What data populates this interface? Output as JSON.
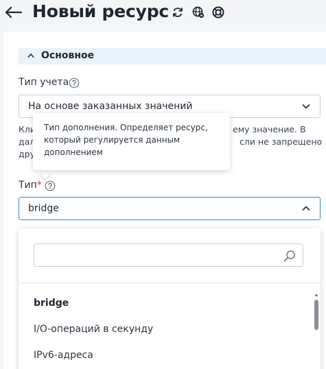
{
  "header": {
    "title": "Новый ресурс",
    "icons": [
      "back-arrow-icon",
      "refresh-icon",
      "globe-gear-icon",
      "lifebuoy-icon"
    ]
  },
  "section": {
    "title": "Основное",
    "expanded": true
  },
  "accounting_type": {
    "label": "Тип учета",
    "value": "На основе заказанных значений",
    "hint_lines": [
      "Кли",
      "ему значение. В",
      "дал",
      "сли не запрещено",
      "дру"
    ]
  },
  "tooltip": {
    "lines": [
      "Тип дополнения. Определяет ресурс,",
      "который регулируется данным",
      "дополнением"
    ]
  },
  "type_field": {
    "label": "Тип",
    "required_mark": "*",
    "value": "bridge"
  },
  "dropdown": {
    "search_placeholder": "",
    "options": [
      {
        "label": "bridge",
        "selected": true
      },
      {
        "label": "I/O-операций в секунду",
        "selected": false
      },
      {
        "label": "IPv6-адреса",
        "selected": false
      }
    ]
  },
  "colors": {
    "accent": "#3b82c4",
    "required": "#d9362b",
    "section_bg": "#e9f3fb"
  }
}
